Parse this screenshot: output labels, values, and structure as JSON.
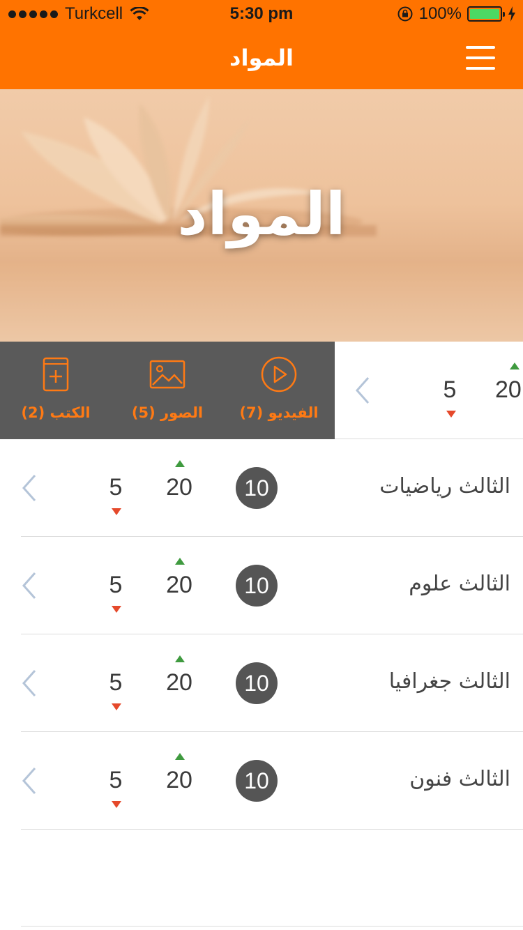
{
  "status_bar": {
    "carrier": "Turkcell",
    "time": "5:30 pm",
    "battery": "100%"
  },
  "nav": {
    "title": "المواد"
  },
  "hero": {
    "title": "المواد"
  },
  "actions": [
    {
      "label": "الكتب (2)",
      "icon": "book-plus-icon"
    },
    {
      "label": "الصور (5)",
      "icon": "image-icon"
    },
    {
      "label": "الفيديو (7)",
      "icon": "play-circle-icon"
    }
  ],
  "partial_row": {
    "up_value": "20",
    "down_value": "5"
  },
  "rows": [
    {
      "title": "الثالث رياضيات",
      "badge": "10",
      "up_value": "20",
      "down_value": "5"
    },
    {
      "title": "الثالث علوم",
      "badge": "10",
      "up_value": "20",
      "down_value": "5"
    },
    {
      "title": "الثالث جغرافيا",
      "badge": "10",
      "up_value": "20",
      "down_value": "5"
    },
    {
      "title": "الثالث فنون",
      "badge": "10",
      "up_value": "20",
      "down_value": "5"
    }
  ],
  "colors": {
    "accent": "#ff7300",
    "strip_bg": "#5a5a5a",
    "up": "#3f9a3f",
    "down": "#e5492b",
    "chevron": "#b4c4d8"
  }
}
